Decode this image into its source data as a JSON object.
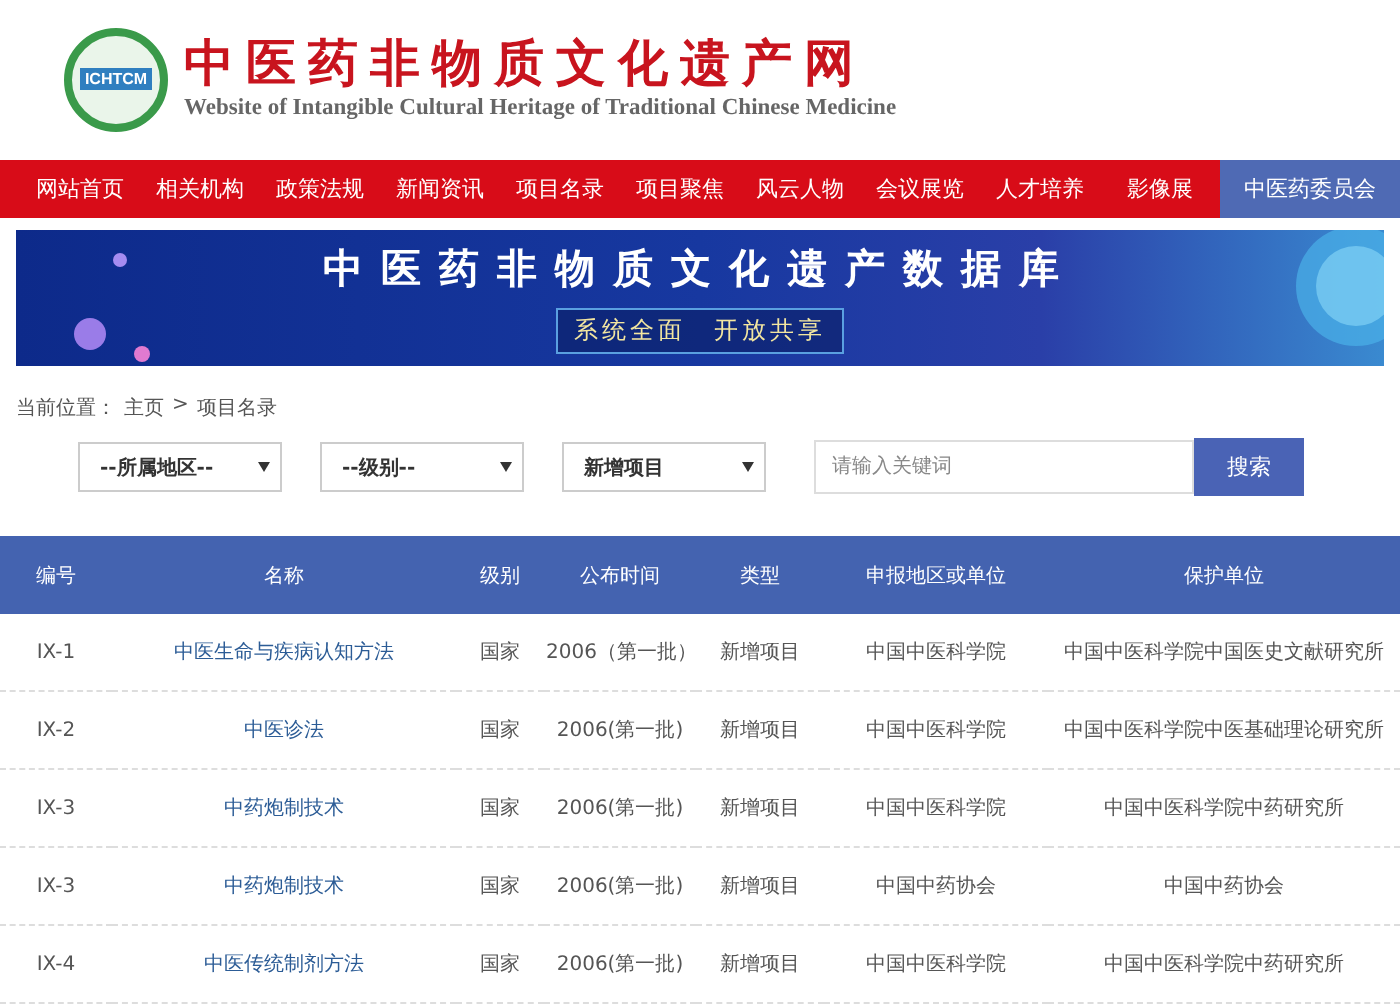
{
  "header": {
    "logo_text": "ICHTCM",
    "title": "中医药非物质文化遗产网",
    "subtitle": "Website of Intangible Cultural Heritage of Traditional Chinese Medicine"
  },
  "nav": [
    {
      "label": "网站首页",
      "selected": false
    },
    {
      "label": "相关机构",
      "selected": false
    },
    {
      "label": "政策法规",
      "selected": false
    },
    {
      "label": "新闻资讯",
      "selected": false
    },
    {
      "label": "项目名录",
      "selected": false
    },
    {
      "label": "项目聚焦",
      "selected": false
    },
    {
      "label": "风云人物",
      "selected": false
    },
    {
      "label": "会议展览",
      "selected": false
    },
    {
      "label": "人才培养",
      "selected": false
    },
    {
      "label": "影像展",
      "selected": false
    },
    {
      "label": "中医药委员会",
      "selected": true
    }
  ],
  "banner": {
    "title": "中医药非物质文化遗产数据库",
    "slogan": "系统全面　开放共享"
  },
  "breadcrumb": {
    "label": "当前位置：",
    "items": [
      "主页",
      "项目名录"
    ],
    "separator": ">"
  },
  "filters": [
    {
      "value": "--所属地区--"
    },
    {
      "value": "--级别--"
    },
    {
      "value": "新增项目"
    }
  ],
  "search": {
    "placeholder": "请输入关键词",
    "button": "搜索"
  },
  "table": {
    "columns": [
      "编号",
      "名称",
      "级别",
      "公布时间",
      "类型",
      "申报地区或单位",
      "保护单位"
    ],
    "rows": [
      [
        "IX-1",
        "中医生命与疾病认知方法",
        "国家",
        "2006（第一批）",
        "新增项目",
        "中国中医科学院",
        "中国中医科学院中国医史文献研究所"
      ],
      [
        "IX-2",
        "中医诊法",
        "国家",
        "2006(第一批)",
        "新增项目",
        "中国中医科学院",
        "中国中医科学院中医基础理论研究所"
      ],
      [
        "IX-3",
        "中药炮制技术",
        "国家",
        "2006(第一批)",
        "新增项目",
        "中国中医科学院",
        "中国中医科学院中药研究所"
      ],
      [
        "IX-3",
        "中药炮制技术",
        "国家",
        "2006(第一批)",
        "新增项目",
        "中国中药协会",
        "中国中药协会"
      ],
      [
        "IX-4",
        "中医传统制剂方法",
        "国家",
        "2006(第一批)",
        "新增项目",
        "中国中医科学院",
        "中国中医科学院中药研究所"
      ]
    ]
  }
}
